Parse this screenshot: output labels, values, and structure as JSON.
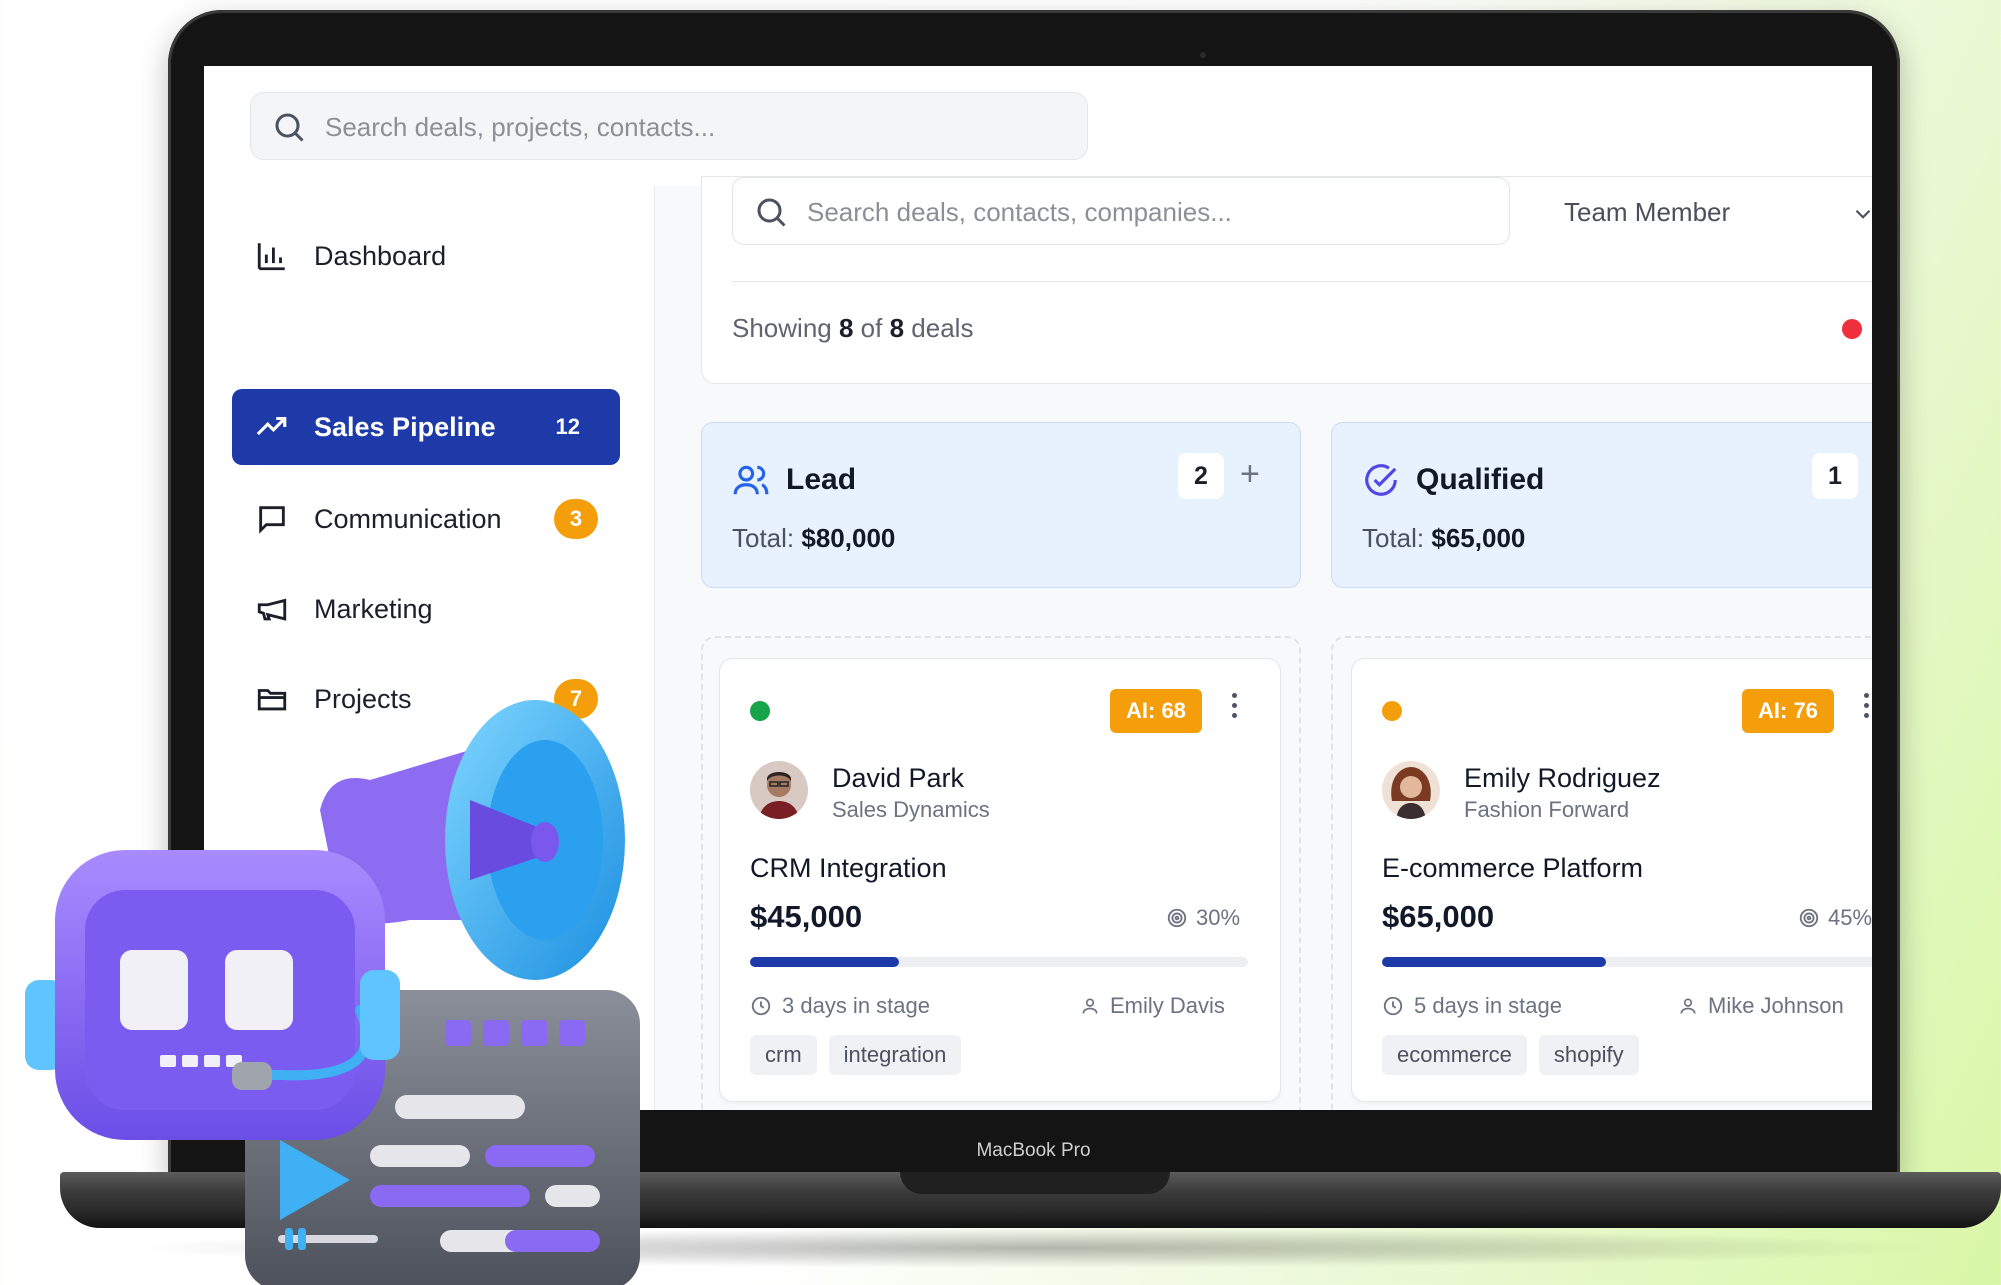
{
  "device": {
    "brand_label": "MacBook Pro"
  },
  "topbar": {
    "search_placeholder": "Search deals, projects, contacts..."
  },
  "sidebar": {
    "items": [
      {
        "label": "Dashboard",
        "icon": "bar-chart-icon",
        "active": false
      },
      {
        "label": "Sales Pipeline",
        "icon": "trending-up-icon",
        "active": true,
        "count": "12"
      },
      {
        "label": "Communication",
        "icon": "message-square-icon",
        "badge": "3"
      },
      {
        "label": "Marketing",
        "icon": "megaphone-icon"
      },
      {
        "label": "Projects",
        "icon": "folder-icon",
        "badge": "7"
      }
    ]
  },
  "filters": {
    "search_placeholder": "Search deals, contacts, companies...",
    "team_select": "Team Member",
    "showing_prefix": "Showing",
    "showing_count": "8",
    "showing_of": "of",
    "showing_total": "8",
    "showing_suffix": "deals"
  },
  "stages": [
    {
      "name": "Lead",
      "icon": "users-icon",
      "total_label": "Total:",
      "total": "$80,000",
      "count": "2",
      "add": "+"
    },
    {
      "name": "Qualified",
      "icon": "check-circle-icon",
      "total_label": "Total:",
      "total": "$65,000",
      "count": "1"
    }
  ],
  "deals": [
    {
      "status_color": "#16a34a",
      "ai_score": "AI: 68",
      "contact_name": "David Park",
      "company": "Sales Dynamics",
      "title": "CRM Integration",
      "amount": "$45,000",
      "probability": "30%",
      "probability_value": 0.3,
      "time_in_stage": "3 days in stage",
      "owner": "Emily Davis",
      "tags": [
        "crm",
        "integration"
      ]
    },
    {
      "status_color": "#f59e0b",
      "ai_score": "AI: 76",
      "contact_name": "Emily Rodriguez",
      "company": "Fashion Forward",
      "title": "E-commerce Platform",
      "amount": "$65,000",
      "probability": "45%",
      "probability_value": 0.45,
      "time_in_stage": "5 days in stage",
      "owner": "Mike Johnson",
      "tags": [
        "ecommerce",
        "shopify"
      ]
    }
  ],
  "colors": {
    "primary": "#1e3aa8",
    "accent": "#f59e0b",
    "stage_bg": "#e8f1fe",
    "live_dot": "#ef2f3b"
  }
}
